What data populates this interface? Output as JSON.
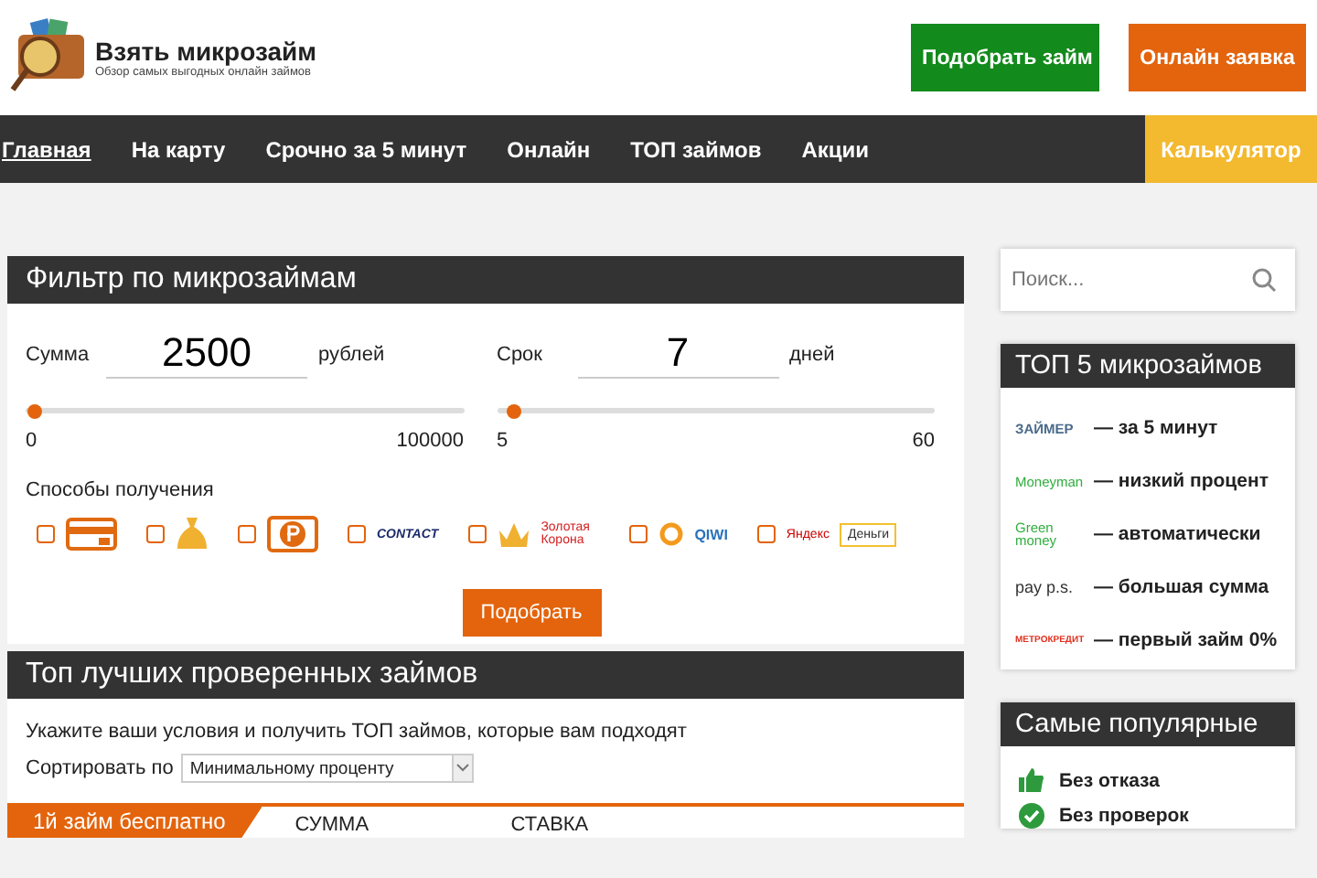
{
  "header": {
    "site_title": "Взять микрозайм",
    "tagline": "Обзор самых выгодных онлайн займов",
    "buttons": [
      {
        "label": "Подобрать займ",
        "kind": "green"
      },
      {
        "label": "Онлайн заявка",
        "kind": "orange"
      }
    ]
  },
  "nav": {
    "items": [
      {
        "label": "Главная",
        "selected": true
      },
      {
        "label": "На карту",
        "selected": false
      },
      {
        "label": "Срочно за 5 минут",
        "selected": false
      },
      {
        "label": "Онлайн",
        "selected": false
      },
      {
        "label": "ТОП займов",
        "selected": false
      },
      {
        "label": "Акции",
        "selected": false
      }
    ],
    "calculator": "Калькулятор"
  },
  "filter": {
    "title": "Фильтр по микрозаймам",
    "sliders": [
      {
        "label": "Сумма",
        "value": "2500",
        "unit": "рублей",
        "level": 0.02,
        "min": "0",
        "max": "100000"
      },
      {
        "label": "Срок",
        "value": "7",
        "unit": "дней",
        "level": 0.04,
        "min": "5",
        "max": "60"
      }
    ],
    "methods_label": "Способы получения",
    "methods": [
      {
        "kind": "card",
        "checked": false
      },
      {
        "kind": "bag",
        "checked": false
      },
      {
        "kind": "ruble",
        "checked": false
      },
      {
        "kind": "contact",
        "checked": false,
        "logo": "CONTACT"
      },
      {
        "kind": "korona",
        "checked": false,
        "logo": "Золотая Корона"
      },
      {
        "kind": "qiwi",
        "checked": false,
        "logo": "QIWI"
      },
      {
        "kind": "yandex",
        "checked": false,
        "logo": "Яндекс",
        "badge": "Деньги"
      }
    ],
    "submit": "Подобрать"
  },
  "top": {
    "title": "Топ лучших проверенных займов",
    "intro": "Укажите ваши условия и получить ТОП займов, которые вам подходят",
    "sort_label": "Сортировать по",
    "sort_value": "Минимальному проценту",
    "tab": "1й займ бесплатно",
    "columns": [
      "СУММА",
      "СТАВКА"
    ]
  },
  "sidebar": {
    "search_placeholder": "Поиск...",
    "top5": {
      "title": "ТОП 5 микрозаймов",
      "items": [
        {
          "kind": "zaymer",
          "logo": "ЗАЙМЕР",
          "text": "— за 5 минут"
        },
        {
          "kind": "moneyman",
          "logo": "Moneyman",
          "text": "— низкий процент"
        },
        {
          "kind": "green",
          "logo": "Green money",
          "text": "— автоматически"
        },
        {
          "kind": "payps",
          "logo": "pay p.s.",
          "text": "— большая сумма"
        },
        {
          "kind": "metro",
          "logo": "МЕТРОКРЕДИТ",
          "text": "— первый займ 0%"
        }
      ]
    },
    "popular": {
      "title": "Самые популярные",
      "items": [
        {
          "kind": "thumb",
          "label": "Без отказа"
        },
        {
          "kind": "check",
          "label": "Без проверок"
        }
      ]
    }
  }
}
